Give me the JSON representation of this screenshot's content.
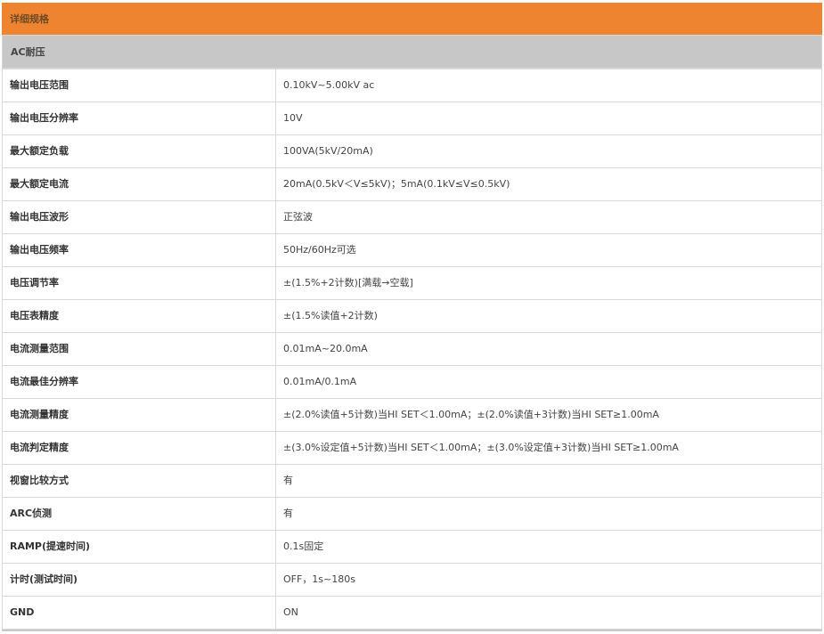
{
  "header": {
    "title": "详细规格"
  },
  "section": {
    "title": "AC耐压"
  },
  "specs": [
    {
      "label": "输出电压范围",
      "value": "0.10kV~5.00kV ac"
    },
    {
      "label": "输出电压分辨率",
      "value": "10V"
    },
    {
      "label": "最大额定负载",
      "value": "100VA(5kV/20mA)"
    },
    {
      "label": "最大额定电流",
      "value": "20mA(0.5kV＜V≤5kV)；5mA(0.1kV≤V≤0.5kV)"
    },
    {
      "label": "输出电压波形",
      "value": "正弦波"
    },
    {
      "label": "输出电压频率",
      "value": "50Hz/60Hz可选"
    },
    {
      "label": "电压调节率",
      "value": "±(1.5%+2计数)[满载→空载]"
    },
    {
      "label": "电压表精度",
      "value": "±(1.5%读值+2计数)"
    },
    {
      "label": "电流测量范围",
      "value": "0.01mA~20.0mA"
    },
    {
      "label": "电流最佳分辨率",
      "value": "0.01mA/0.1mA"
    },
    {
      "label": "电流测量精度",
      "value": "±(2.0%读值+5计数)当HI SET＜1.00mA；±(2.0%读值+3计数)当HI SET≥1.00mA"
    },
    {
      "label": "电流判定精度",
      "value": "±(3.0%设定值+5计数)当HI SET＜1.00mA；±(3.0%设定值+3计数)当HI SET≥1.00mA"
    },
    {
      "label": "视窗比较方式",
      "value": "有"
    },
    {
      "label": "ARC侦测",
      "value": "有"
    },
    {
      "label": "RAMP(提速时间)",
      "value": "0.1s固定"
    },
    {
      "label": "计时(测试时间)",
      "value": "OFF，1s~180s"
    },
    {
      "label": "GND",
      "value": "ON"
    }
  ],
  "colors": {
    "header_bg": "#ee8430",
    "section_bg": "#c7c7c7",
    "border": "#d9d9d9"
  }
}
